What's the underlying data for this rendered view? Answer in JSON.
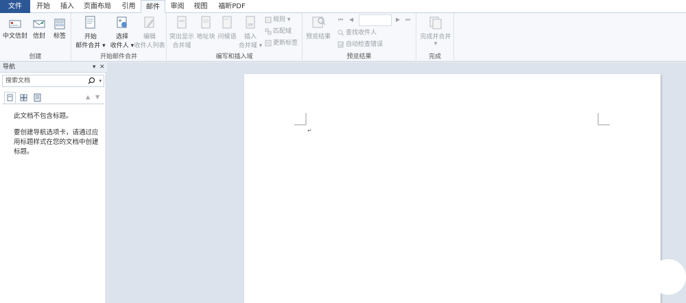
{
  "tabs": [
    "文件",
    "开始",
    "插入",
    "页面布局",
    "引用",
    "邮件",
    "审阅",
    "视图",
    "福昕PDF"
  ],
  "ribbon": {
    "create": {
      "label": "创建",
      "btn1": "中文信封",
      "btn2": "信封",
      "btn3": "标签"
    },
    "start_merge": {
      "label": "开始邮件合并",
      "btn1_l1": "开始",
      "btn1_l2": "邮件合并 ▾",
      "btn2_l1": "选择",
      "btn2_l2": "收件人 ▾",
      "btn3_l1": "编辑",
      "btn3_l2": "收件人列表"
    },
    "write_insert": {
      "label": "编写和插入域",
      "btn1_l1": "突出显示",
      "btn1_l2": "合并域",
      "btn2": "地址块",
      "btn3": "问候语",
      "btn4_l1": "插入",
      "btn4_l2": "合并域 ▾",
      "small1": "规则 ▾",
      "small2": "匹配域",
      "small3": "更新标签"
    },
    "preview": {
      "label": "预览结果",
      "btn1": "预览结果",
      "small1": "查找收件人",
      "small2": "自动检查错误"
    },
    "finish": {
      "label": "完成",
      "btn1": "完成并合并",
      "btn1_arrow": "▾"
    }
  },
  "nav_pane": {
    "title": "导航",
    "pin": "▾",
    "close": "✕",
    "search_placeholder": "搜索文档",
    "message1": "此文档不包含标题。",
    "message2": "要创建导航选项卡，请通过应用标题样式在您的文档中创建标题。"
  },
  "document": {
    "paragraph_mark": "↵"
  },
  "colors": {
    "file_tab": "#2b5797",
    "ribbon_bg": "#f6f8fb",
    "doc_bg": "#dce3ec"
  }
}
